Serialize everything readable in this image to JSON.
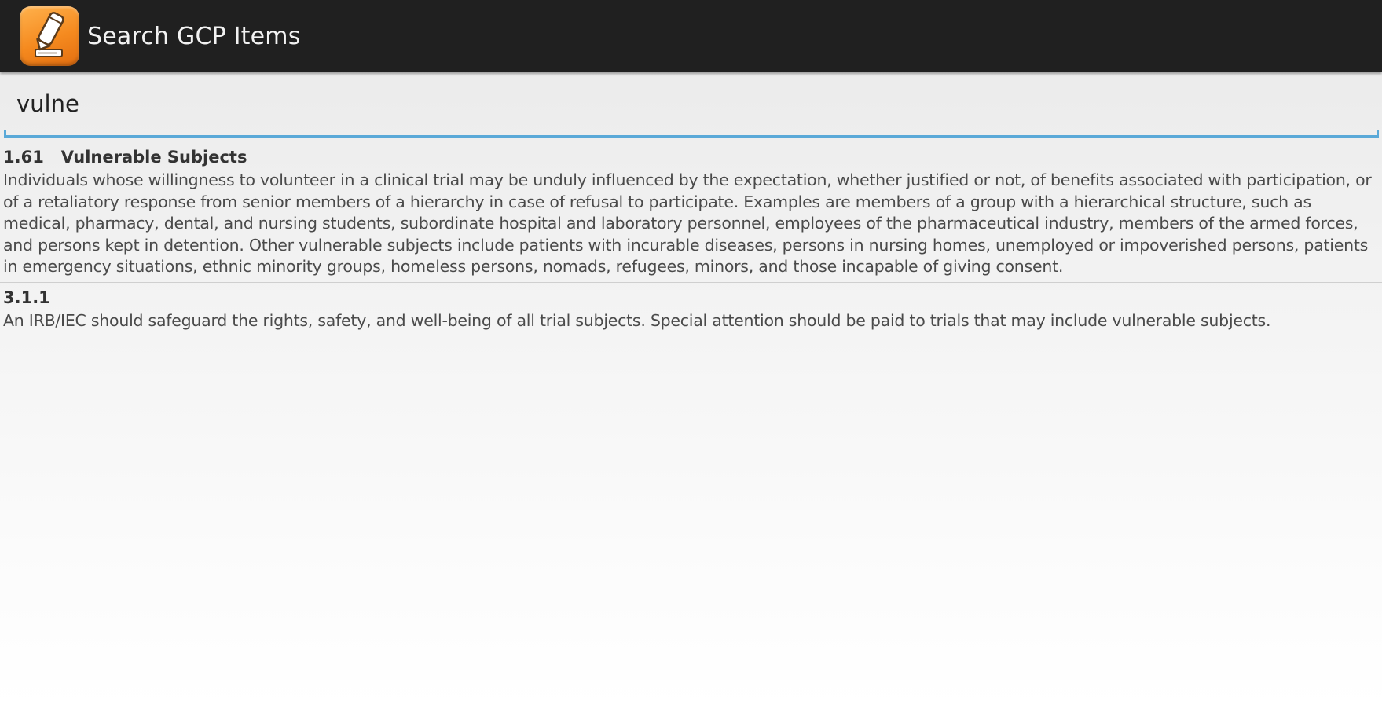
{
  "app": {
    "title": "Search GCP Items",
    "icon": "notepad-pencil-icon",
    "colors": {
      "action_bar": "#202020",
      "icon_accent": "#f58a1f",
      "search_underline": "#5aa9d8"
    }
  },
  "search": {
    "value": "vulne"
  },
  "results": [
    {
      "title": "1.61   Vulnerable Subjects",
      "body": "Individuals whose willingness to volunteer in a clinical trial may be unduly influenced by the expectation, whether justified or not, of benefits associated with participation, or of a retaliatory response from senior members of a hierarchy in case of refusal to participate. Examples are members of a group with a hierarchical structure, such as medical, pharmacy, dental, and nursing students, subordinate hospital and laboratory personnel, employees of the pharmaceutical industry, members of the armed forces, and persons kept in detention. Other vulnerable subjects include patients with incurable diseases, persons in nursing homes, unemployed or impoverished persons, patients in emergency situations, ethnic minority groups, homeless persons, nomads, refugees, minors, and those incapable of giving consent."
    },
    {
      "title": "3.1.1",
      "body": "An IRB/IEC should safeguard the rights, safety, and well-being of all trial subjects. Special attention should be paid to trials that may include vulnerable subjects."
    }
  ]
}
